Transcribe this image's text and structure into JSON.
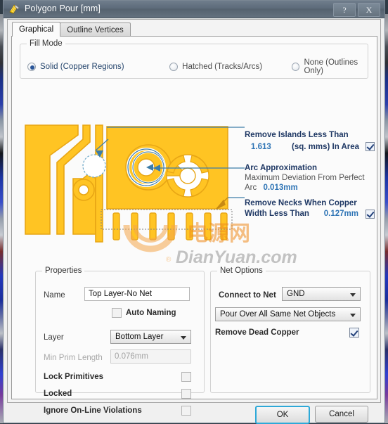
{
  "window": {
    "title": "Polygon Pour [mm]",
    "icon": "polygon-pour-icon",
    "help_label": "?",
    "close_label": "X"
  },
  "tabs": [
    {
      "label": "Graphical",
      "active": true
    },
    {
      "label": "Outline Vertices",
      "active": false
    }
  ],
  "fill_mode": {
    "title": "Fill Mode",
    "options": [
      {
        "label": "Solid (Copper Regions)",
        "selected": true
      },
      {
        "label": "Hatched (Tracks/Arcs)",
        "selected": false
      },
      {
        "label": "None (Outlines Only)",
        "selected": false
      }
    ]
  },
  "annotations": {
    "remove_islands": {
      "title": "Remove Islands Less Than",
      "value": "1.613",
      "units": "(sq. mms) In Area",
      "checked": true
    },
    "arc_approximation": {
      "title": "Arc Approximation",
      "desc": "Maximum Deviation From Perfect",
      "desc2": "Arc",
      "value": "0.013mm"
    },
    "remove_necks": {
      "title": "Remove Necks When Copper",
      "title2": "Width Less Than",
      "value": "0.127mm",
      "checked": true
    }
  },
  "properties": {
    "title": "Properties",
    "name_label": "Name",
    "name_value": "Top Layer-No Net",
    "auto_naming_label": "Auto Naming",
    "auto_naming_checked": false,
    "layer_label": "Layer",
    "layer_value": "Bottom Layer",
    "min_prim_label": "Min Prim Length",
    "min_prim_value": "0.076mm",
    "min_prim_disabled": true,
    "lock_primitives_label": "Lock Primitives",
    "lock_primitives_checked": false,
    "locked_label": "Locked",
    "locked_checked": false,
    "ignore_violations_label": "Ignore On-Line Violations",
    "ignore_violations_checked": false
  },
  "net_options": {
    "title": "Net Options",
    "connect_label": "Connect to Net",
    "connect_value": "GND",
    "pour_value": "Pour Over All Same Net Objects",
    "remove_dead_copper_label": "Remove Dead Copper",
    "remove_dead_copper_checked": true
  },
  "footer": {
    "ok_label": "OK",
    "cancel_label": "Cancel"
  },
  "watermark": {
    "text": "DianYuan.com",
    "registered": "®",
    "cjk": "电源网"
  },
  "colors": {
    "copper": "#FFC423",
    "copper_edge": "#E8A615",
    "annotation_heading": "#1F3864",
    "value_blue": "#2E74B5",
    "leader": "#3C7CA8",
    "accent_button": "#2EA9D8",
    "watermark_orange": "#F5A64B"
  }
}
